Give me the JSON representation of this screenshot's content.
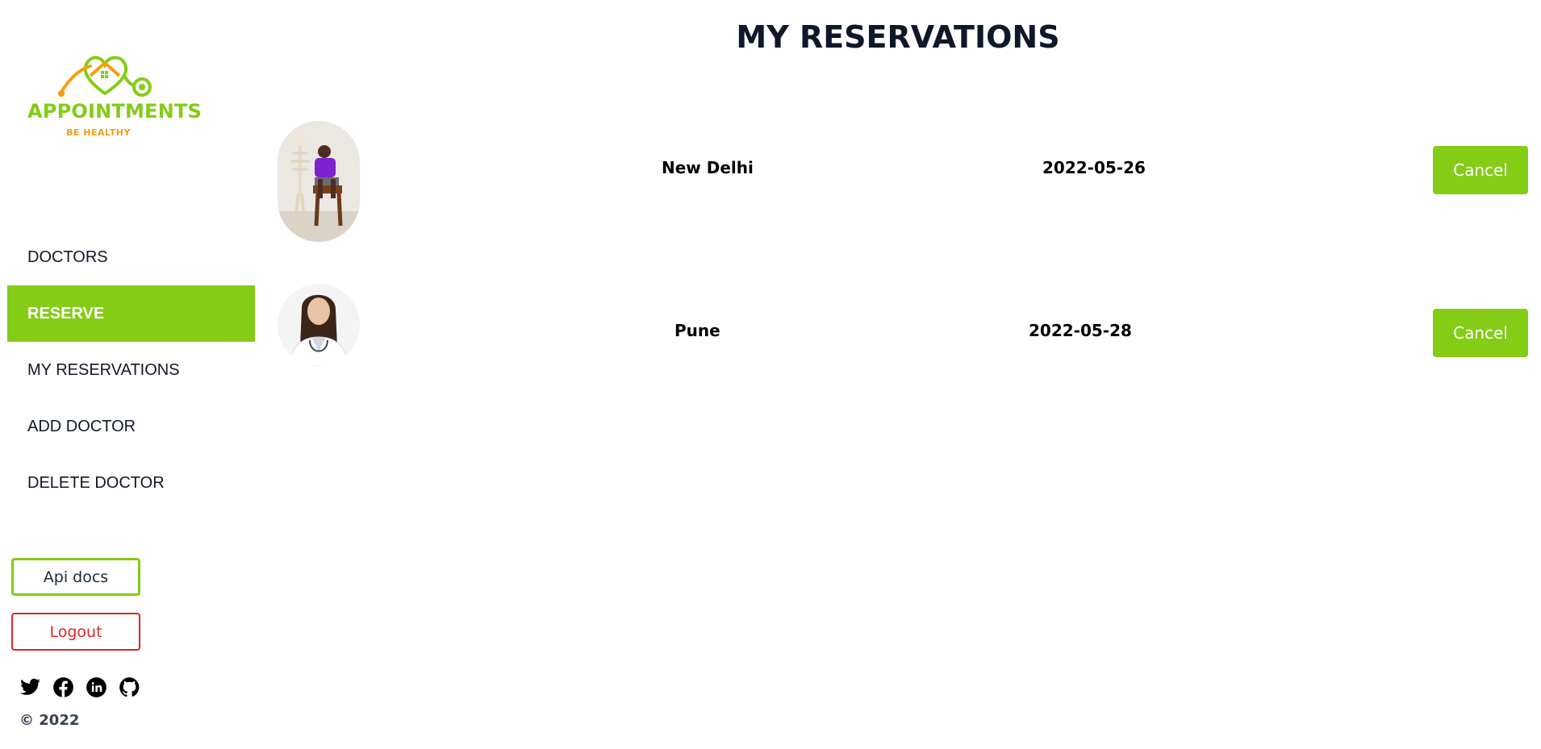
{
  "brand": {
    "name": "APPOINTMENTS",
    "tagline": "BE HEALTHY",
    "logo_icon": "heart-stethoscope-house-logo",
    "primary_color": "#84cc16",
    "accent_color": "#f59e0b"
  },
  "sidebar": {
    "items": [
      {
        "label": "DOCTORS",
        "active": false
      },
      {
        "label": "RESERVE",
        "active": true
      },
      {
        "label": "MY RESERVATIONS",
        "active": false
      },
      {
        "label": "ADD DOCTOR",
        "active": false
      },
      {
        "label": "DELETE DOCTOR",
        "active": false
      }
    ],
    "api_docs_label": "Api docs",
    "logout_label": "Logout",
    "socials": [
      "twitter-icon",
      "facebook-icon",
      "linkedin-icon",
      "github-icon"
    ],
    "copyright": "© 2022"
  },
  "main": {
    "title": "MY RESERVATIONS",
    "reservations": [
      {
        "city": "New Delhi",
        "date": "2022-05-26",
        "cancel_label": "Cancel",
        "photo": "doctor-man-skeleton-photo"
      },
      {
        "city": "Pune",
        "date": "2022-05-28",
        "cancel_label": "Cancel",
        "photo": "doctor-woman-photo"
      }
    ]
  },
  "colors": {
    "logout": "#dc2626",
    "text": "#111827"
  }
}
